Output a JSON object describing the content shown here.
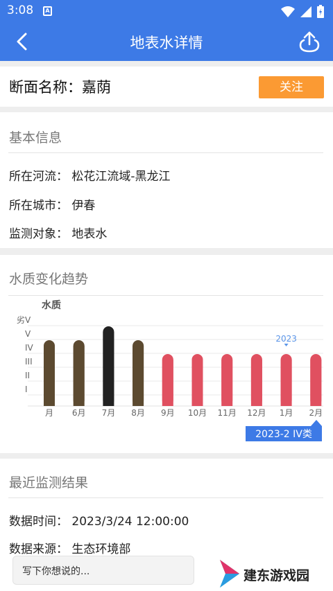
{
  "status_bar": {
    "time": "3:08",
    "badge": "A"
  },
  "app_bar": {
    "title": "地表水详情"
  },
  "section": {
    "name_label": "断面名称：",
    "name_value": "嘉荫",
    "follow_label": "关注"
  },
  "basic_info": {
    "title": "基本信息",
    "rows": [
      {
        "label": "所在河流：",
        "value": "松花江流域-黑龙江"
      },
      {
        "label": "所在城市：",
        "value": "伊春"
      },
      {
        "label": "监测对象：",
        "value": "地表水"
      }
    ]
  },
  "trend": {
    "title": "水质变化趋势"
  },
  "chart_data": {
    "type": "bar",
    "ylabel": "水质",
    "y_categories": [
      "I",
      "II",
      "III",
      "IV",
      "V",
      "劣V"
    ],
    "categories": [
      "月",
      "6月",
      "7月",
      "8月",
      "9月",
      "10月",
      "11月",
      "12月",
      "1月",
      "2月"
    ],
    "values": [
      5,
      5,
      6,
      5,
      4,
      4,
      4,
      4,
      4,
      4
    ],
    "highlight_index": 2,
    "year_marker": {
      "label": "2023",
      "index": 8
    },
    "tooltip": "2023-2 IV类",
    "colors": {
      "V": "#5c4a30",
      "IV": "#e05060",
      "selected": "#222222"
    }
  },
  "result": {
    "title": "最近监测结果",
    "rows": [
      {
        "label": "数据时间：",
        "value": "2023/3/24 12:00:00"
      },
      {
        "label": "数据来源：",
        "value": "生态环境部"
      }
    ]
  },
  "input": {
    "placeholder": "写下你想说的..."
  },
  "watermark": {
    "text": "建东游戏园"
  }
}
